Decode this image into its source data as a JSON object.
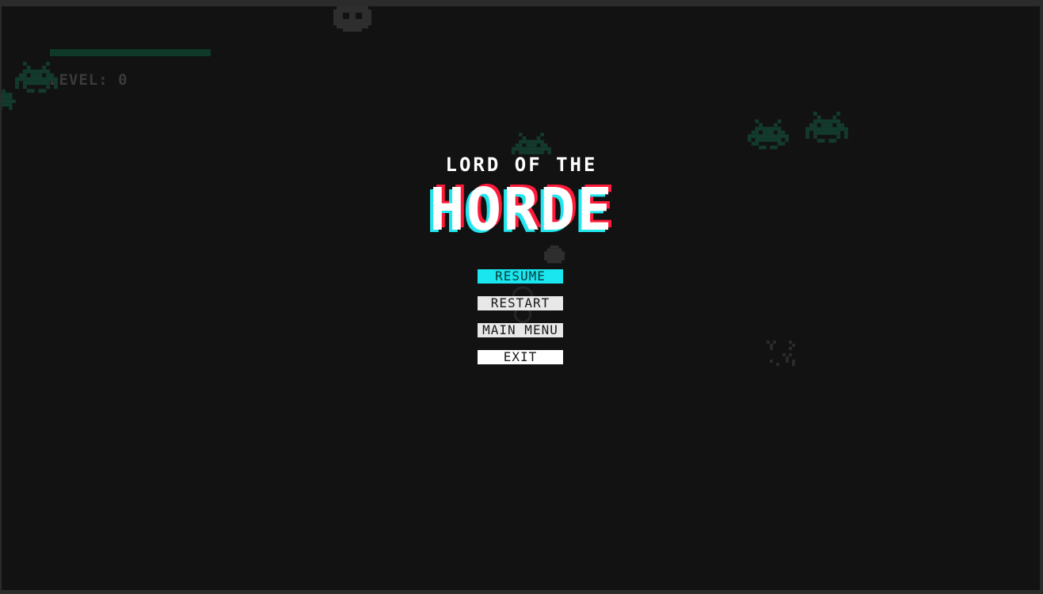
{
  "hud": {
    "level_text": "LEVEL: 0"
  },
  "title": {
    "line1": "LORD OF THE",
    "line2": "HORDE"
  },
  "pause_menu": {
    "items": [
      {
        "label": "RESUME",
        "selected": true
      },
      {
        "label": "RESTART",
        "selected": false
      },
      {
        "label": "MAIN MENU",
        "selected": false
      },
      {
        "label": "EXIT",
        "selected": false
      }
    ]
  },
  "colors": {
    "background": "#121212",
    "accent_cyan": "#19e6ee",
    "accent_red": "#ff1a3a",
    "enemy": "#123a2c"
  },
  "icons": [
    "space-invader-enemy-icon",
    "ghost-enemy-icon",
    "blob-enemy-icon",
    "bat-enemy-icon"
  ]
}
